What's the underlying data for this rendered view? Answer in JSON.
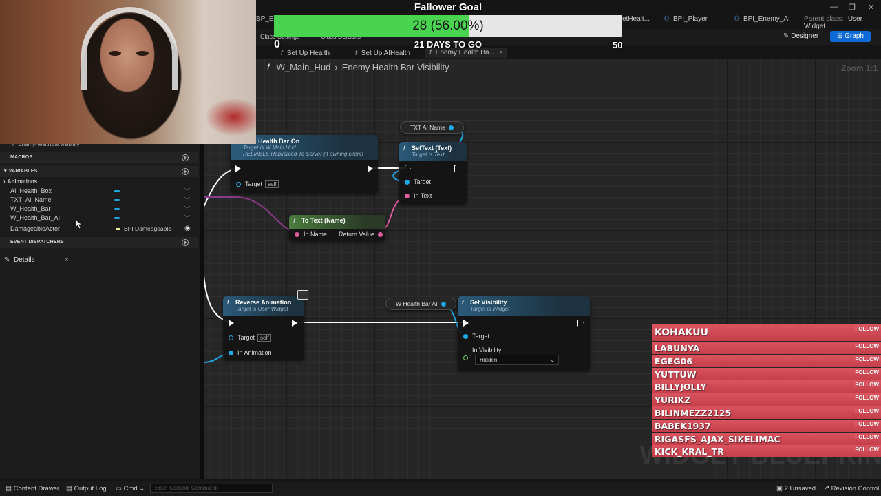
{
  "window": {
    "asset_tabs": [
      {
        "label": "BP_Ene"
      },
      {
        "label": "etHealt..."
      },
      {
        "label": "BPI_Player"
      },
      {
        "label": "BPI_Enemy_AI"
      }
    ],
    "parent_class_label": "Parent class:",
    "parent_class_value": "User Widget",
    "controls": {
      "minimize": "—",
      "maximize": "❐",
      "close": "✕"
    }
  },
  "toolbar": {
    "class_settings": "Class Settings",
    "class_defaults": "Class Defaults",
    "designer": "Designer",
    "graph": "Graph"
  },
  "graph_tabs": [
    {
      "label": "Set Up Health"
    },
    {
      "label": "Set Up AIHealth"
    },
    {
      "label": "Enemy Health Ba..."
    }
  ],
  "breadcrumb": {
    "root": "W_Main_Hud",
    "current": "Enemy Health Bar Visibility"
  },
  "zoom": "Zoom 1:1",
  "watermark": "WIDGET BLUEPRINT",
  "nodes": {
    "health_bar_on": {
      "title": "er AI Health Bar On",
      "sub1": "Target is W Main Hud",
      "sub2": "RELIABLE Replicated To Server (if owning client)",
      "target": "Target",
      "self": "self"
    },
    "txt_ai_name": {
      "label": "TXT AI Name"
    },
    "set_text": {
      "title": "SetText (Text)",
      "sub": "Target is Text",
      "target": "Target",
      "in_text": "In Text"
    },
    "to_text": {
      "title": "To Text (Name)",
      "in_name": "In Name",
      "return_value": "Return Value"
    },
    "reverse_animation": {
      "title": "Reverse Animation",
      "sub": "Target is User Widget",
      "target": "Target",
      "self": "self",
      "in_animation": "In Animation"
    },
    "w_health_bar_ai": {
      "label": "W Health Bar AI"
    },
    "set_visibility": {
      "title": "Set Visibility",
      "sub": "Target is Widget",
      "target": "Target",
      "in_visibility": "In Visibility",
      "value": "Hidden"
    }
  },
  "left_panel": {
    "top_item": "EnemyHealthBarVisibility",
    "sections": {
      "macros": "MACROS",
      "variables": "VARIABLES",
      "event_dispatchers": "EVENT DISPATCHERS"
    },
    "category": "Animations",
    "variables": [
      {
        "name": "AI_Health_Box"
      },
      {
        "name": "TXT_AI_Name"
      },
      {
        "name": "W_Health_Bar"
      },
      {
        "name": "W_Health_Bar_AI"
      },
      {
        "name": "DamageableActor",
        "type": "BPI Dameageable"
      }
    ],
    "details_tab": "Details"
  },
  "bottom_bar": {
    "content_drawer": "Content Drawer",
    "output_log": "Output Log",
    "cmd": "Cmd",
    "console_placeholder": "Enter Console Command",
    "unsaved": "2 Unsaved",
    "revision_control": "Revision Control"
  },
  "stream_overlay": {
    "goal_title": "Fallower Goal",
    "goal_progress": 0.56,
    "goal_text": "28 (56.00%)",
    "goal_min": "0",
    "goal_max": "50",
    "days_left": "21 DAYS TO GO",
    "follow_label": "FOLLOW",
    "followers": [
      "KOHAKUU",
      "LABUNYA",
      "EGEG06",
      "YUTTUW",
      "BILLYJOLLY",
      "YURIKZ",
      "BILINMEZZ2125",
      "BABEK1937",
      "RIGASFS_AJAX_SIKELIMAC",
      "KICK_KRAL_TR"
    ]
  },
  "colors": {
    "accent": "#0e6ad6",
    "exec": "#ffffff",
    "object_pin": "#1ea8e6",
    "text_pin": "#e05c9e",
    "follow_bg": "#d9545e",
    "goal_fill": "#49d44f"
  }
}
